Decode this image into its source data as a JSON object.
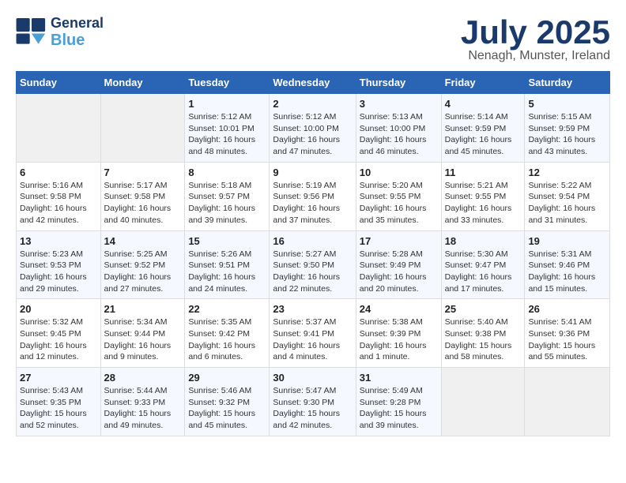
{
  "header": {
    "logo_line1": "General",
    "logo_line2": "Blue",
    "month_title": "July 2025",
    "subtitle": "Nenagh, Munster, Ireland"
  },
  "days_of_week": [
    "Sunday",
    "Monday",
    "Tuesday",
    "Wednesday",
    "Thursday",
    "Friday",
    "Saturday"
  ],
  "weeks": [
    [
      {
        "day": "",
        "content": ""
      },
      {
        "day": "",
        "content": ""
      },
      {
        "day": "1",
        "content": "Sunrise: 5:12 AM\nSunset: 10:01 PM\nDaylight: 16 hours and 48 minutes."
      },
      {
        "day": "2",
        "content": "Sunrise: 5:12 AM\nSunset: 10:00 PM\nDaylight: 16 hours and 47 minutes."
      },
      {
        "day": "3",
        "content": "Sunrise: 5:13 AM\nSunset: 10:00 PM\nDaylight: 16 hours and 46 minutes."
      },
      {
        "day": "4",
        "content": "Sunrise: 5:14 AM\nSunset: 9:59 PM\nDaylight: 16 hours and 45 minutes."
      },
      {
        "day": "5",
        "content": "Sunrise: 5:15 AM\nSunset: 9:59 PM\nDaylight: 16 hours and 43 minutes."
      }
    ],
    [
      {
        "day": "6",
        "content": "Sunrise: 5:16 AM\nSunset: 9:58 PM\nDaylight: 16 hours and 42 minutes."
      },
      {
        "day": "7",
        "content": "Sunrise: 5:17 AM\nSunset: 9:58 PM\nDaylight: 16 hours and 40 minutes."
      },
      {
        "day": "8",
        "content": "Sunrise: 5:18 AM\nSunset: 9:57 PM\nDaylight: 16 hours and 39 minutes."
      },
      {
        "day": "9",
        "content": "Sunrise: 5:19 AM\nSunset: 9:56 PM\nDaylight: 16 hours and 37 minutes."
      },
      {
        "day": "10",
        "content": "Sunrise: 5:20 AM\nSunset: 9:55 PM\nDaylight: 16 hours and 35 minutes."
      },
      {
        "day": "11",
        "content": "Sunrise: 5:21 AM\nSunset: 9:55 PM\nDaylight: 16 hours and 33 minutes."
      },
      {
        "day": "12",
        "content": "Sunrise: 5:22 AM\nSunset: 9:54 PM\nDaylight: 16 hours and 31 minutes."
      }
    ],
    [
      {
        "day": "13",
        "content": "Sunrise: 5:23 AM\nSunset: 9:53 PM\nDaylight: 16 hours and 29 minutes."
      },
      {
        "day": "14",
        "content": "Sunrise: 5:25 AM\nSunset: 9:52 PM\nDaylight: 16 hours and 27 minutes."
      },
      {
        "day": "15",
        "content": "Sunrise: 5:26 AM\nSunset: 9:51 PM\nDaylight: 16 hours and 24 minutes."
      },
      {
        "day": "16",
        "content": "Sunrise: 5:27 AM\nSunset: 9:50 PM\nDaylight: 16 hours and 22 minutes."
      },
      {
        "day": "17",
        "content": "Sunrise: 5:28 AM\nSunset: 9:49 PM\nDaylight: 16 hours and 20 minutes."
      },
      {
        "day": "18",
        "content": "Sunrise: 5:30 AM\nSunset: 9:47 PM\nDaylight: 16 hours and 17 minutes."
      },
      {
        "day": "19",
        "content": "Sunrise: 5:31 AM\nSunset: 9:46 PM\nDaylight: 16 hours and 15 minutes."
      }
    ],
    [
      {
        "day": "20",
        "content": "Sunrise: 5:32 AM\nSunset: 9:45 PM\nDaylight: 16 hours and 12 minutes."
      },
      {
        "day": "21",
        "content": "Sunrise: 5:34 AM\nSunset: 9:44 PM\nDaylight: 16 hours and 9 minutes."
      },
      {
        "day": "22",
        "content": "Sunrise: 5:35 AM\nSunset: 9:42 PM\nDaylight: 16 hours and 6 minutes."
      },
      {
        "day": "23",
        "content": "Sunrise: 5:37 AM\nSunset: 9:41 PM\nDaylight: 16 hours and 4 minutes."
      },
      {
        "day": "24",
        "content": "Sunrise: 5:38 AM\nSunset: 9:39 PM\nDaylight: 16 hours and 1 minute."
      },
      {
        "day": "25",
        "content": "Sunrise: 5:40 AM\nSunset: 9:38 PM\nDaylight: 15 hours and 58 minutes."
      },
      {
        "day": "26",
        "content": "Sunrise: 5:41 AM\nSunset: 9:36 PM\nDaylight: 15 hours and 55 minutes."
      }
    ],
    [
      {
        "day": "27",
        "content": "Sunrise: 5:43 AM\nSunset: 9:35 PM\nDaylight: 15 hours and 52 minutes."
      },
      {
        "day": "28",
        "content": "Sunrise: 5:44 AM\nSunset: 9:33 PM\nDaylight: 15 hours and 49 minutes."
      },
      {
        "day": "29",
        "content": "Sunrise: 5:46 AM\nSunset: 9:32 PM\nDaylight: 15 hours and 45 minutes."
      },
      {
        "day": "30",
        "content": "Sunrise: 5:47 AM\nSunset: 9:30 PM\nDaylight: 15 hours and 42 minutes."
      },
      {
        "day": "31",
        "content": "Sunrise: 5:49 AM\nSunset: 9:28 PM\nDaylight: 15 hours and 39 minutes."
      },
      {
        "day": "",
        "content": ""
      },
      {
        "day": "",
        "content": ""
      }
    ]
  ]
}
